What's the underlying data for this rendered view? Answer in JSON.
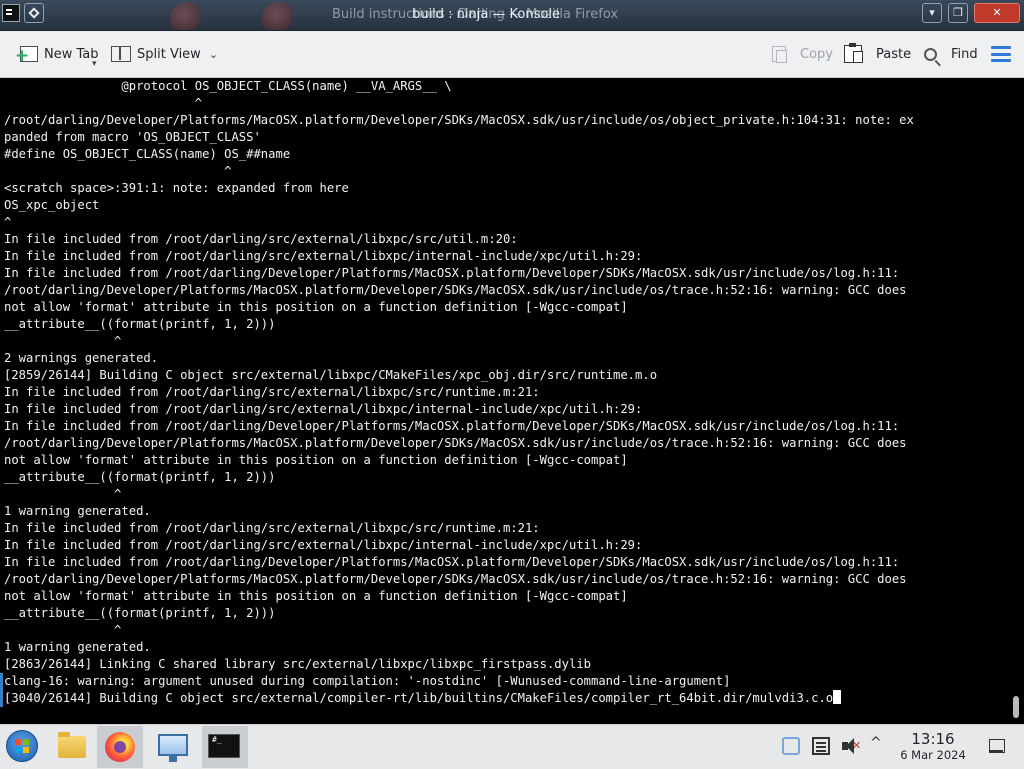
{
  "window": {
    "title_back": "Build instructions - Darling — Mozilla Firefox",
    "title_front": "build : ninja — Konsole",
    "minimize_label": "▾",
    "maximize_label": "▴",
    "restore_label": "❐",
    "close_label": "✕"
  },
  "toolbar": {
    "new_tab": "New Tab",
    "split_view": "Split View",
    "copy": "Copy",
    "paste": "Paste",
    "find": "Find"
  },
  "terminal": {
    "lines": [
      "                @protocol OS_OBJECT_CLASS(name) __VA_ARGS__ \\",
      "                          ^",
      "/root/darling/Developer/Platforms/MacOSX.platform/Developer/SDKs/MacOSX.sdk/usr/include/os/object_private.h:104:31: note: ex",
      "panded from macro 'OS_OBJECT_CLASS'",
      "#define OS_OBJECT_CLASS(name) OS_##name",
      "                              ^",
      "<scratch space>:391:1: note: expanded from here",
      "OS_xpc_object",
      "^",
      "In file included from /root/darling/src/external/libxpc/src/util.m:20:",
      "In file included from /root/darling/src/external/libxpc/internal-include/xpc/util.h:29:",
      "In file included from /root/darling/Developer/Platforms/MacOSX.platform/Developer/SDKs/MacOSX.sdk/usr/include/os/log.h:11:",
      "/root/darling/Developer/Platforms/MacOSX.platform/Developer/SDKs/MacOSX.sdk/usr/include/os/trace.h:52:16: warning: GCC does",
      "not allow 'format' attribute in this position on a function definition [-Wgcc-compat]",
      "__attribute__((format(printf, 1, 2)))",
      "               ^",
      "2 warnings generated.",
      "[2859/26144] Building C object src/external/libxpc/CMakeFiles/xpc_obj.dir/src/runtime.m.o",
      "In file included from /root/darling/src/external/libxpc/src/runtime.m:21:",
      "In file included from /root/darling/src/external/libxpc/internal-include/xpc/util.h:29:",
      "In file included from /root/darling/Developer/Platforms/MacOSX.platform/Developer/SDKs/MacOSX.sdk/usr/include/os/log.h:11:",
      "/root/darling/Developer/Platforms/MacOSX.platform/Developer/SDKs/MacOSX.sdk/usr/include/os/trace.h:52:16: warning: GCC does",
      "not allow 'format' attribute in this position on a function definition [-Wgcc-compat]",
      "__attribute__((format(printf, 1, 2)))",
      "               ^",
      "1 warning generated.",
      "In file included from /root/darling/src/external/libxpc/src/runtime.m:21:",
      "In file included from /root/darling/src/external/libxpc/internal-include/xpc/util.h:29:",
      "In file included from /root/darling/Developer/Platforms/MacOSX.platform/Developer/SDKs/MacOSX.sdk/usr/include/os/log.h:11:",
      "/root/darling/Developer/Platforms/MacOSX.platform/Developer/SDKs/MacOSX.sdk/usr/include/os/trace.h:52:16: warning: GCC does",
      "not allow 'format' attribute in this position on a function definition [-Wgcc-compat]",
      "__attribute__((format(printf, 1, 2)))",
      "               ^",
      "1 warning generated.",
      "[2863/26144] Linking C shared library src/external/libxpc/libxpc_firstpass.dylib",
      "clang-16: warning: argument unused during compilation: '-nostdinc' [-Wunused-command-line-argument]",
      "[3040/26144] Building C object src/external/compiler-rt/lib/builtins/CMakeFiles/compiler_rt_64bit.dir/mulvdi3.c.o"
    ]
  },
  "taskbar": {
    "konsole_icon_text": "#_",
    "clock_time": "13:16",
    "clock_date": "6 Mar 2024",
    "tray_up": "^",
    "vol_x": "✕"
  },
  "icons": {
    "app": "terminal-icon",
    "menu": "window-menu-icon",
    "new_tab": "new-tab-icon",
    "split_view": "split-view-icon",
    "copy": "copy-icon",
    "paste": "paste-icon",
    "find": "search-icon",
    "hamburger": "hamburger-menu-icon"
  },
  "colors": {
    "terminal_bg": "#000000",
    "terminal_fg": "#f2f2f2",
    "accent": "#2d7bd6",
    "close": "#c0392b"
  }
}
